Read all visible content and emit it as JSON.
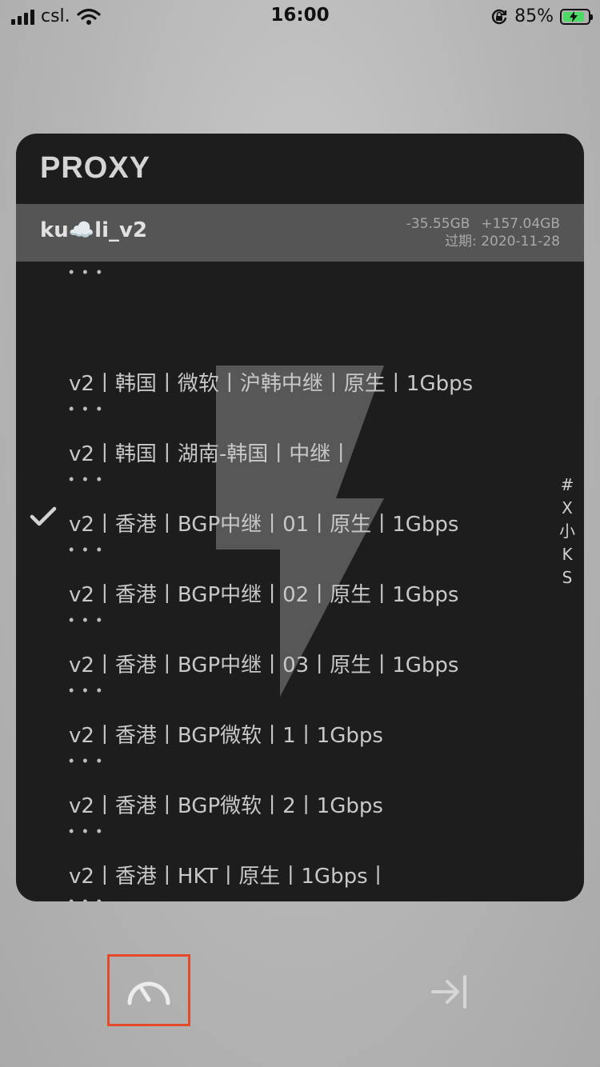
{
  "status_bar": {
    "carrier": "csl.",
    "time": "16:00",
    "battery_percent": "85%",
    "battery_level": 0.85,
    "icons": [
      "signal-icon",
      "wifi-icon",
      "orientation-lock-icon",
      "battery-charging-icon"
    ]
  },
  "card": {
    "title": "PROXY",
    "subscription": {
      "name": "ku☁️li_v2",
      "upload": "-35.55GB",
      "download": "+157.04GB",
      "expiry": "过期: 2020-11-28"
    },
    "proxies": [
      {
        "name": "v2丨韩国丨微软丨沪韩中继丨原生丨1Gbps",
        "selected": false
      },
      {
        "name": "v2丨韩国丨湖南-韩国丨中继丨",
        "selected": false
      },
      {
        "name": "v2丨香港丨BGP中继丨01丨原生丨1Gbps",
        "selected": true
      },
      {
        "name": "v2丨香港丨BGP中继丨02丨原生丨1Gbps",
        "selected": false
      },
      {
        "name": "v2丨香港丨BGP中继丨03丨原生丨1Gbps",
        "selected": false
      },
      {
        "name": "v2丨香港丨BGP微软丨1丨1Gbps",
        "selected": false
      },
      {
        "name": "v2丨香港丨BGP微软丨2丨1Gbps",
        "selected": false
      },
      {
        "name": "v2丨香港丨HKT丨原生丨1Gbps丨",
        "selected": false
      }
    ],
    "dots": "• • •",
    "index_letters": [
      "#",
      "X",
      "小",
      "K",
      "S"
    ]
  },
  "bottom": {
    "speed_test_icon": "speedometer-icon",
    "exit_icon": "arrow-to-right-icon",
    "colors": {
      "highlight_border": "#e5492c"
    }
  }
}
